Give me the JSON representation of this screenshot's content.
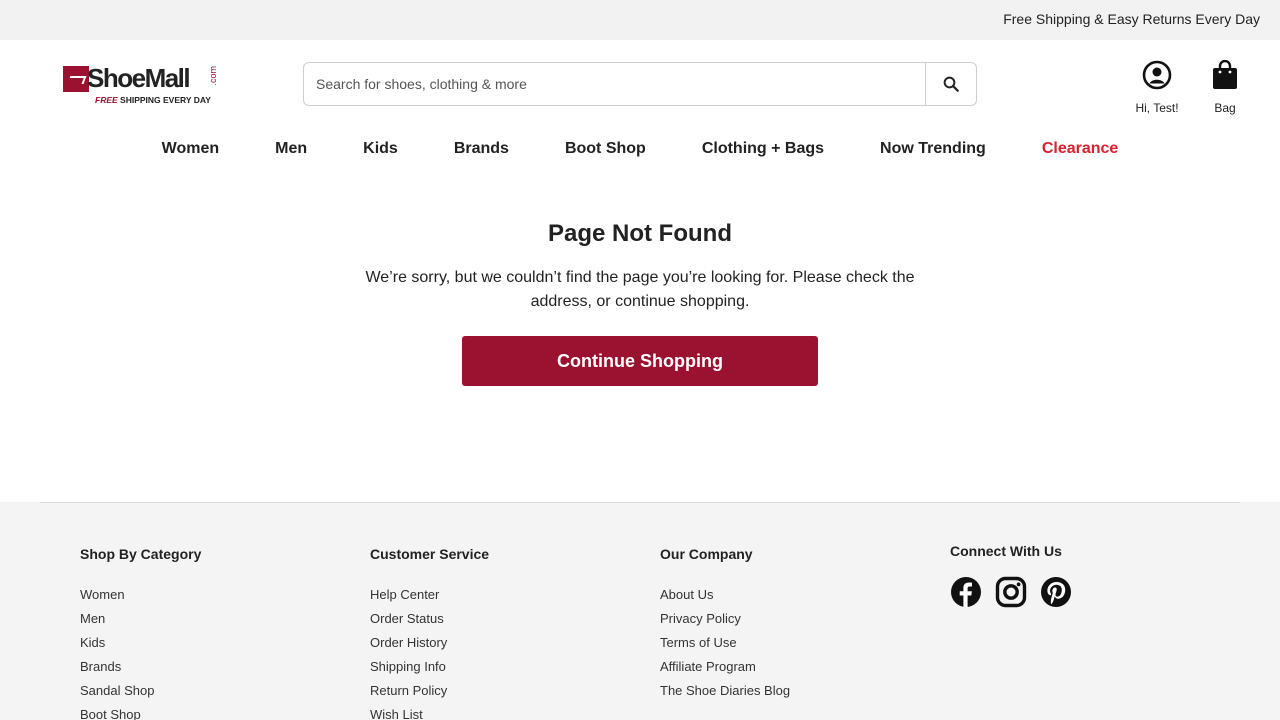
{
  "promo": {
    "text": "Free Shipping & Easy Returns Every Day"
  },
  "logo": {
    "name": "ShoeMall",
    "dotcom": ".com",
    "tag_free": "FREE",
    "tag_rest": " SHIPPING EVERY DAY"
  },
  "search": {
    "placeholder": "Search for shoes, clothing & more",
    "value": "",
    "icon": "search-icon"
  },
  "account": {
    "label": "Hi, Test!",
    "icon": "user-circle-icon"
  },
  "bag": {
    "label": "Bag",
    "icon": "shopping-bag-icon"
  },
  "nav": {
    "items": [
      {
        "label": "Women"
      },
      {
        "label": "Men"
      },
      {
        "label": "Kids"
      },
      {
        "label": "Brands"
      },
      {
        "label": "Boot Shop"
      },
      {
        "label": "Clothing + Bags"
      },
      {
        "label": "Now Trending"
      },
      {
        "label": "Clearance",
        "color": "#d9212f"
      }
    ]
  },
  "content": {
    "title": "Page Not Found",
    "message": "We’re sorry, but we couldn’t find the page you’re looking for. Please check the address, or continue shopping.",
    "cta": "Continue Shopping"
  },
  "footer": {
    "shop": {
      "title": "Shop By Category",
      "links": [
        "Women",
        "Men",
        "Kids",
        "Brands",
        "Sandal Shop",
        "Boot Shop"
      ]
    },
    "service": {
      "title": "Customer Service",
      "links": [
        "Help Center",
        "Order Status",
        "Order History",
        "Shipping Info",
        "Return Policy",
        "Wish List"
      ]
    },
    "company": {
      "title": "Our Company",
      "links": [
        "About Us",
        "Privacy Policy",
        "Terms of Use",
        "Affiliate Program",
        "The Shoe Diaries Blog"
      ]
    },
    "connect": {
      "title": "Connect With Us",
      "icons": [
        "facebook-icon",
        "instagram-icon",
        "pinterest-icon"
      ]
    }
  },
  "colors": {
    "brand": "#9b1230",
    "clearance": "#d9212f",
    "footer_bg": "#f4f4f4"
  }
}
